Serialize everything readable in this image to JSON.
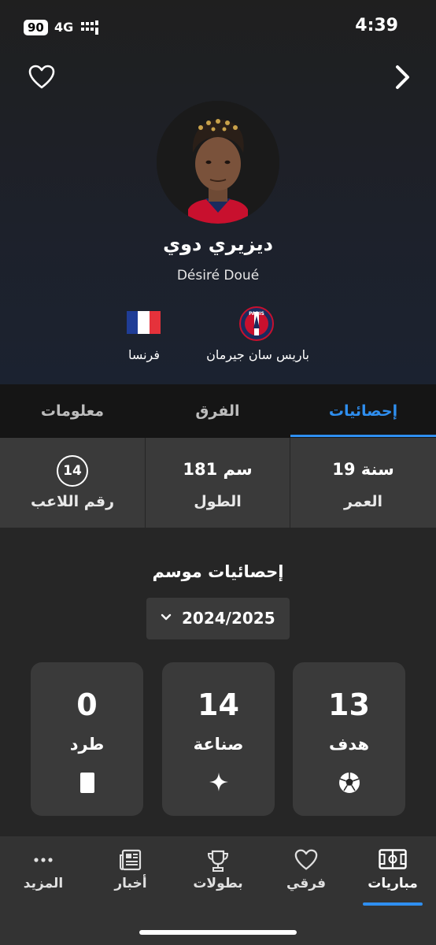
{
  "status": {
    "battery": "90",
    "network": "4G",
    "time": "4:39"
  },
  "player": {
    "name_ar": "ديزيري دوي",
    "name_latin": "Désiré Doué"
  },
  "country": {
    "name": "فرنسا",
    "flag_colors": [
      "#1f3d96",
      "#ffffff",
      "#e5323b"
    ]
  },
  "club": {
    "name": "باريس سان جيرمان",
    "logo_text": "PARIS"
  },
  "tabs": [
    {
      "label": "إحصائيات",
      "active": true
    },
    {
      "label": "الفرق"
    },
    {
      "label": "معلومات"
    }
  ],
  "info": {
    "age": {
      "value": "19 سنة",
      "label": "العمر"
    },
    "height": {
      "value": "181 سم",
      "label": "الطول"
    },
    "number": {
      "value": "14",
      "label": "رقم اللاعب"
    }
  },
  "season": {
    "title": "إحصائيات موسم",
    "selected": "2024/2025"
  },
  "stats": [
    {
      "value": "13",
      "label": "هدف",
      "icon": "football-icon"
    },
    {
      "value": "14",
      "label": "صناعة",
      "icon": "sparkle-icon"
    },
    {
      "value": "0",
      "label": "طرد",
      "icon": "red-card-icon"
    }
  ],
  "nav": [
    {
      "label": "مباريات",
      "icon": "pitch-icon",
      "active": true
    },
    {
      "label": "فرقي",
      "icon": "heart-icon"
    },
    {
      "label": "بطولات",
      "icon": "trophy-icon"
    },
    {
      "label": "أخبار",
      "icon": "news-icon"
    },
    {
      "label": "المزيد",
      "icon": "more-icon"
    }
  ],
  "colors": {
    "accent": "#2f8ff0",
    "background": "#262626",
    "card": "#3a3a3a"
  }
}
